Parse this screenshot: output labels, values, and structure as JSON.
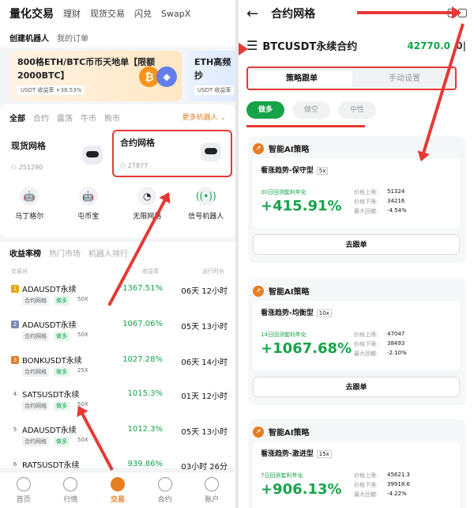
{
  "left": {
    "top_tabs": [
      "量化交易",
      "理财",
      "现货交易",
      "闪兑",
      "SwapX"
    ],
    "sub_tabs": [
      "创建机器人",
      "我的订单"
    ],
    "banner1": {
      "title": "800格ETH/BTC币币天地单【限额2000BTC】",
      "sub": "USDT 收益率 +38.53%"
    },
    "banner2": {
      "title": "ETH高频抄",
      "sub": "USDT 收益率"
    },
    "filters": [
      "全部",
      "合约",
      "震荡",
      "牛市",
      "熊市"
    ],
    "more_bots": "更多机器人",
    "spot_grid": {
      "title": "现货网格",
      "count": "251290"
    },
    "contract_grid": {
      "title": "合约网格",
      "count": "27877"
    },
    "icons": [
      {
        "label": "马丁格尔"
      },
      {
        "label": "屯币宝"
      },
      {
        "label": "无限网格"
      },
      {
        "label": "信号机器人"
      }
    ],
    "list_tabs": [
      "收益率榜",
      "热门市场",
      "机器人排行"
    ],
    "list_head": {
      "pair": "交易对",
      "rate": "收益率",
      "time": "运行时长"
    },
    "rows": [
      {
        "rank": "1",
        "name": "ADAUSDT永续",
        "tag1": "合约网格",
        "tag2": "做多",
        "lev": "50X",
        "rate": "1367.51%",
        "time": "06天 12小时"
      },
      {
        "rank": "2",
        "name": "ADAUSDT永续",
        "tag1": "合约网格",
        "tag2": "做多",
        "lev": "50X",
        "rate": "1067.06%",
        "time": "05天 13小时"
      },
      {
        "rank": "3",
        "name": "BONKUSDT永续",
        "tag1": "合约网格",
        "tag2": "做多",
        "lev": "25X",
        "rate": "1027.28%",
        "time": "06天 14小时"
      },
      {
        "rank": "4",
        "name": "SATSUSDT永续",
        "tag1": "合约网格",
        "tag2": "做多",
        "lev": "50X",
        "rate": "1015.3%",
        "time": "01天 12小时"
      },
      {
        "rank": "5",
        "name": "ADAUSDT永续",
        "tag1": "合约网格",
        "tag2": "做多",
        "lev": "50X",
        "rate": "1012.3%",
        "time": "05天 13小时"
      },
      {
        "rank": "6",
        "name": "RATSUSDT永续",
        "tag1": "",
        "tag2": "",
        "lev": "",
        "rate": "939.86%",
        "time": "03小时 26分"
      }
    ],
    "nav": [
      "首页",
      "行情",
      "交易",
      "合约",
      "账户"
    ]
  },
  "right": {
    "header_title": "合约网格",
    "pair_title": "BTCUSDT永续合约",
    "price": "42770.0",
    "seg": [
      "策略跟单",
      "手动设置"
    ],
    "dirs": [
      "做多",
      "做空",
      "中性"
    ],
    "strategies": [
      {
        "head": "智能AI策略",
        "trend": "看涨趋势-保守型",
        "lever": "5x",
        "ret_label": "30日回测套利年化",
        "ret": "+415.91%",
        "k1": "价格上限:",
        "v1": "51324",
        "k2": "价格下限:",
        "v2": "34216",
        "k3": "最大回撤:",
        "v3": "-4.54%",
        "follow": "去跟单"
      },
      {
        "head": "智能AI策略",
        "trend": "看涨趋势-均衡型",
        "lever": "10x",
        "ret_label": "14日回测套利年化",
        "ret": "+1067.68%",
        "k1": "价格上限:",
        "v1": "47047",
        "k2": "价格下限:",
        "v2": "38493",
        "k3": "最大回撤:",
        "v3": "-2.10%",
        "follow": "去跟单"
      },
      {
        "head": "智能AI策略",
        "trend": "看涨趋势-激进型",
        "lever": "15x",
        "ret_label": "7日回测套利年化",
        "ret": "+906.13%",
        "k1": "价格上限:",
        "v1": "45621.3",
        "k2": "价格下限:",
        "v2": "39918.6",
        "k3": "最大回撤:",
        "v3": "-4.22%",
        "follow": ""
      }
    ]
  }
}
